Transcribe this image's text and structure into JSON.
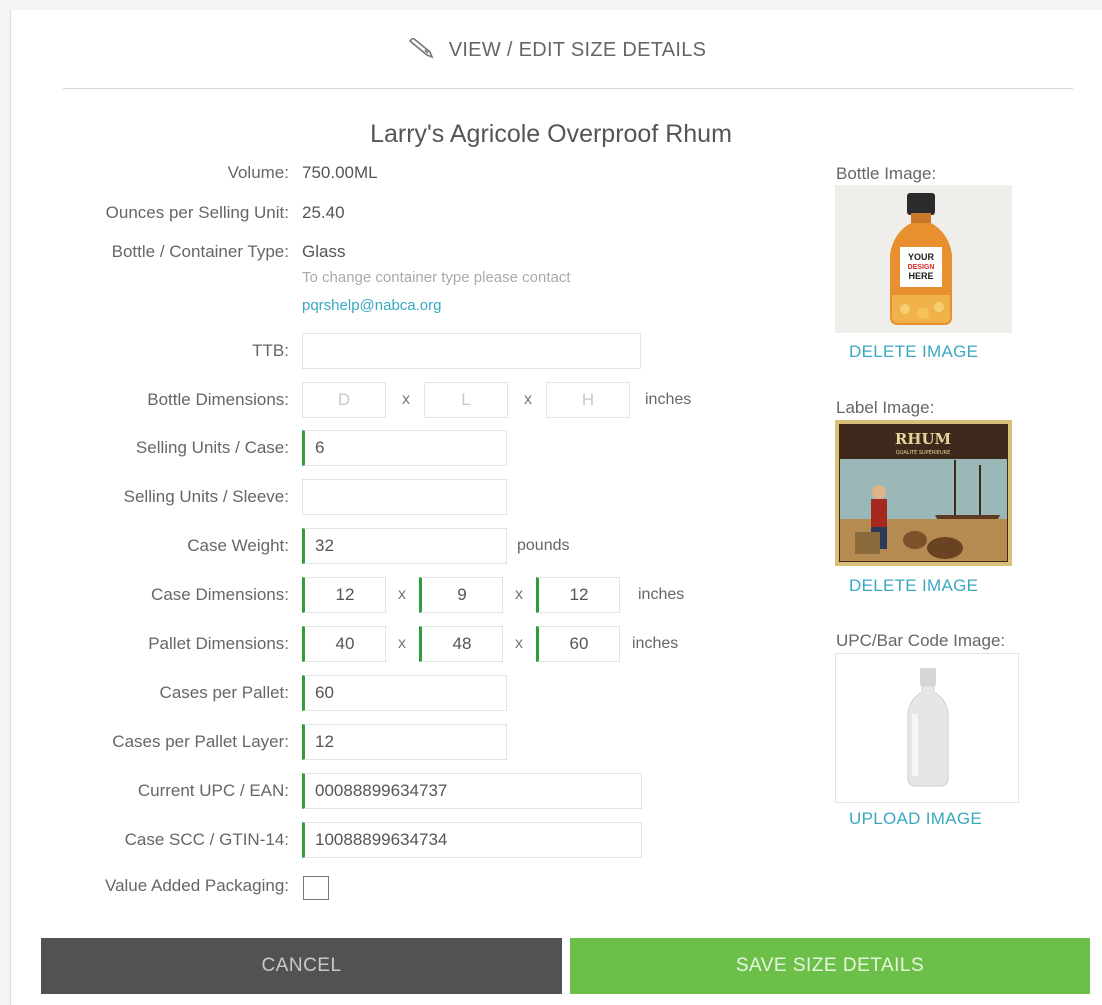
{
  "header": {
    "title": "VIEW / EDIT SIZE DETAILS"
  },
  "product": {
    "name": "Larry's Agricole Overproof Rhum"
  },
  "fields": {
    "volume": {
      "label": "Volume:",
      "value": "750.00ML"
    },
    "ounces": {
      "label": "Ounces per Selling Unit:",
      "value": "25.40"
    },
    "container": {
      "label": "Bottle / Container Type:",
      "value": "Glass",
      "note": "To change container type please contact",
      "email": "pqrshelp@nabca.org"
    },
    "ttb": {
      "label": "TTB:",
      "value": ""
    },
    "bottle_dimensions": {
      "label": "Bottle Dimensions:",
      "placeholders": [
        "D",
        "L",
        "H"
      ],
      "unit": "inches"
    },
    "selling_units_case": {
      "label": "Selling Units / Case:",
      "value": "6"
    },
    "selling_units_sleeve": {
      "label": "Selling Units / Sleeve:",
      "value": ""
    },
    "case_weight": {
      "label": "Case Weight:",
      "value": "32",
      "unit": "pounds"
    },
    "case_dimensions": {
      "label": "Case Dimensions:",
      "values": [
        "12",
        "9",
        "12"
      ],
      "unit": "inches"
    },
    "pallet_dimensions": {
      "label": "Pallet Dimensions:",
      "values": [
        "40",
        "48",
        "60"
      ],
      "unit": "inches"
    },
    "cases_per_pallet": {
      "label": "Cases per Pallet:",
      "value": "60"
    },
    "cases_per_pallet_layer": {
      "label": "Cases per Pallet Layer:",
      "value": "12"
    },
    "upc": {
      "label": "Current UPC / EAN:",
      "value": "00088899634737"
    },
    "scc": {
      "label": "Case SCC / GTIN-14:",
      "value": "10088899634734"
    },
    "value_added": {
      "label": "Value Added Packaging:",
      "checked": false
    }
  },
  "x_sep": "x",
  "images": {
    "bottle": {
      "label": "Bottle Image:",
      "action": "DELETE IMAGE",
      "text": [
        "YOUR",
        "DESIGN",
        "HERE"
      ]
    },
    "label": {
      "label": "Label Image:",
      "action": "DELETE IMAGE",
      "text": [
        "RHUM",
        "QUALITÉ SUPÉRIEURE"
      ]
    },
    "upc": {
      "label": "UPC/Bar Code Image:",
      "action": "UPLOAD IMAGE"
    }
  },
  "buttons": {
    "cancel": "CANCEL",
    "save": "SAVE SIZE DETAILS"
  },
  "colors": {
    "accent_green": "#6cc04a",
    "filled_marker": "#2f9e3a",
    "link_blue": "#3aa8c1",
    "cancel_gray": "#505254"
  },
  "icons": {
    "header": "pencil-icon"
  }
}
